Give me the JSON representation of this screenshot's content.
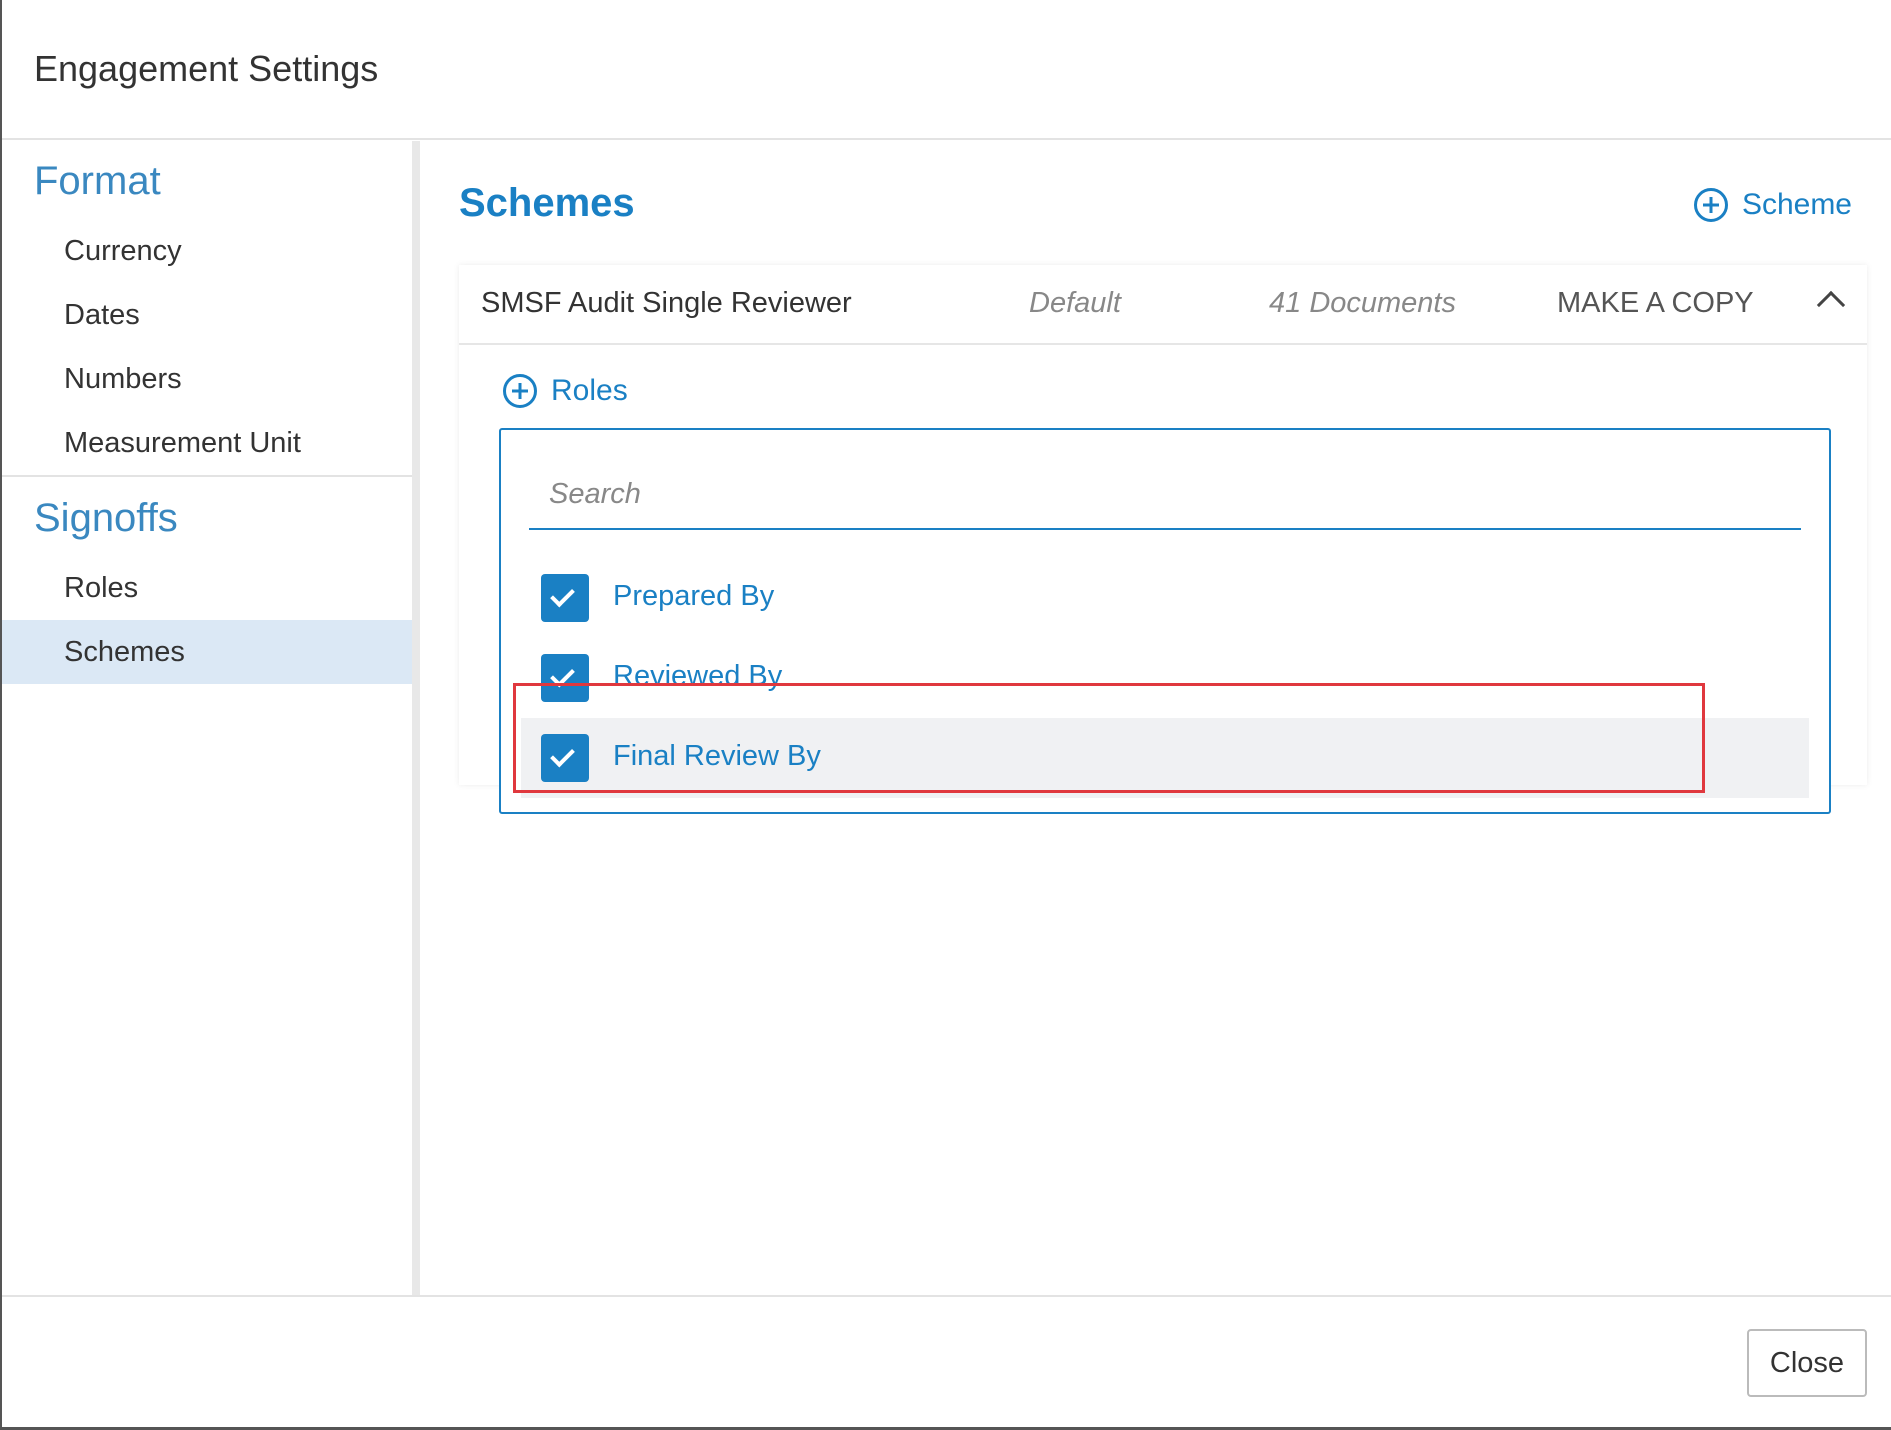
{
  "dialog": {
    "title": "Engagement Settings"
  },
  "sidebar": {
    "format": {
      "title": "Format",
      "items": [
        {
          "label": "Currency"
        },
        {
          "label": "Dates"
        },
        {
          "label": "Numbers"
        },
        {
          "label": "Measurement Unit"
        }
      ]
    },
    "signoffs": {
      "title": "Signoffs",
      "items": [
        {
          "label": "Roles"
        },
        {
          "label": "Schemes",
          "active": true
        }
      ]
    }
  },
  "main": {
    "title": "Schemes",
    "add_scheme_label": "Scheme",
    "scheme": {
      "name": "SMSF Audit Single Reviewer",
      "default_label": "Default",
      "documents_label": "41 Documents",
      "copy_label": "MAKE A COPY"
    },
    "add_role_label": "Roles",
    "search": {
      "placeholder": "Search",
      "value": ""
    },
    "roles": [
      {
        "label": "Prepared By",
        "checked": true
      },
      {
        "label": "Reviewed By",
        "checked": true
      },
      {
        "label": "Final Review By",
        "checked": true,
        "highlighted": true
      }
    ]
  },
  "footer": {
    "close_label": "Close"
  },
  "colors": {
    "accent": "#1a80c4",
    "section_title": "#3a88c0",
    "active_item_bg": "#dbe8f5",
    "annotation": "#e0383e"
  },
  "icons": {
    "add_scheme": "plus-circle-icon",
    "add_role": "plus-circle-icon",
    "collapse": "chevron-up-icon",
    "checkbox": "check-icon"
  }
}
